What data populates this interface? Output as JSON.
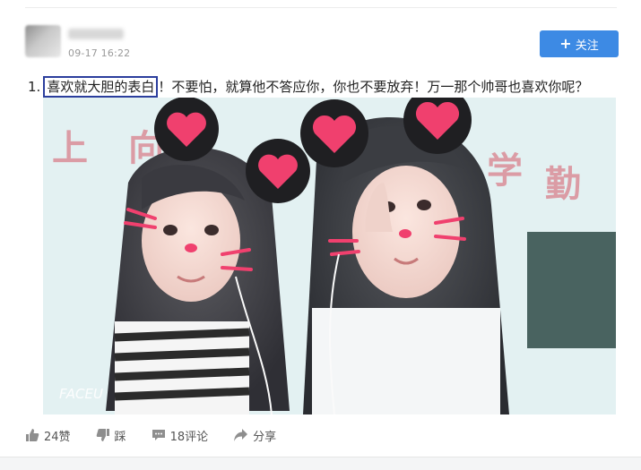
{
  "post": {
    "time": "09-17 16:22",
    "follow_label": "关注",
    "caption": {
      "number": "1.",
      "highlighted": "喜欢就大胆的表白",
      "rest": "！不要怕，就算他不答应你，你也不要放弃！万一那个帅哥也喜欢你呢？"
    },
    "photo": {
      "watermark": "FACEU",
      "wall_text": [
        "上",
        "向",
        "学",
        "勤"
      ]
    }
  },
  "actions": {
    "like_label": "24赞",
    "dislike_label": "踩",
    "comment_label": "18评论",
    "share_label": "分享"
  },
  "colors": {
    "accent": "#3d8ae4",
    "highlight_border": "#2b3e9d",
    "action_icon": "#8e8e8e",
    "heart_pink": "#f0406e"
  },
  "icons": {
    "follow": "plus-icon",
    "like": "thumbs-up-icon",
    "dislike": "thumbs-down-icon",
    "comment": "comment-icon",
    "share": "share-arrow-icon"
  }
}
